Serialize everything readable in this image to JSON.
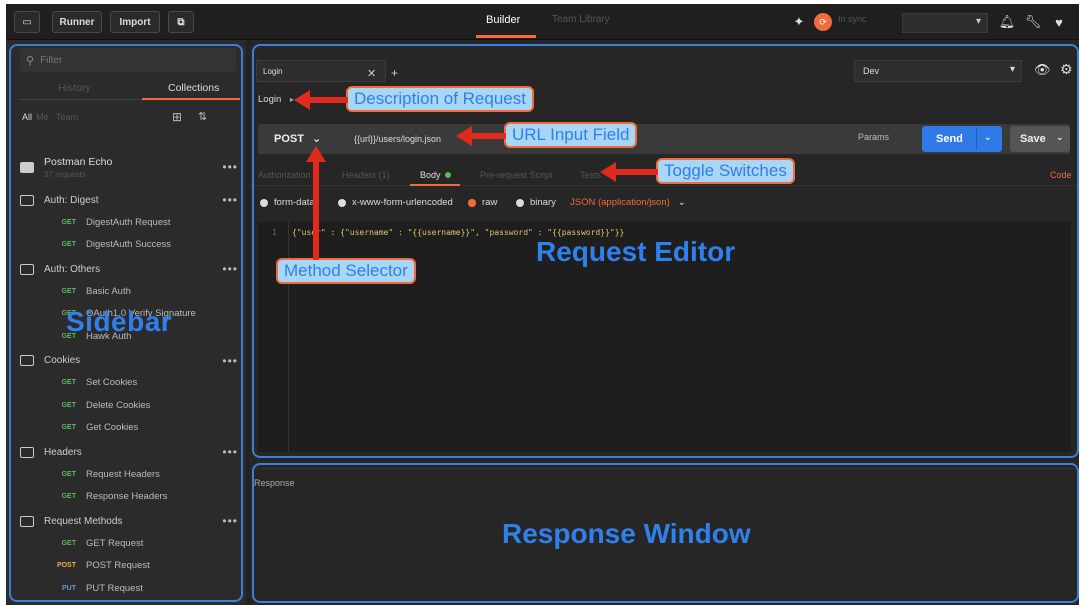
{
  "topbar": {
    "runner_label": "Runner",
    "import_label": "Import",
    "tab_builder": "Builder",
    "tab_team": "Team Library",
    "sync_label": "In sync"
  },
  "sidebar": {
    "filter_placeholder": "Filter",
    "tab_history": "History",
    "tab_collections": "Collections",
    "all_label": "All",
    "me_label": "Me",
    "team_label": "Team",
    "overlay_label": "Sidebar",
    "collection": {
      "name": "Postman Echo",
      "count": "37 requests"
    },
    "folders": [
      {
        "name": "Auth: Digest",
        "requests": [
          {
            "method": "GET",
            "name": "DigestAuth Request"
          },
          {
            "method": "GET",
            "name": "DigestAuth Success"
          }
        ]
      },
      {
        "name": "Auth: Others",
        "requests": [
          {
            "method": "GET",
            "name": "Basic Auth"
          },
          {
            "method": "GET",
            "name": "OAuth1.0 Verify Signature"
          },
          {
            "method": "GET",
            "name": "Hawk Auth"
          }
        ]
      },
      {
        "name": "Cookies",
        "requests": [
          {
            "method": "GET",
            "name": "Set Cookies"
          },
          {
            "method": "GET",
            "name": "Delete Cookies"
          },
          {
            "method": "GET",
            "name": "Get Cookies"
          }
        ]
      },
      {
        "name": "Headers",
        "requests": [
          {
            "method": "GET",
            "name": "Request Headers"
          },
          {
            "method": "GET",
            "name": "Response Headers"
          }
        ]
      },
      {
        "name": "Request Methods",
        "requests": [
          {
            "method": "GET",
            "name": "GET Request"
          },
          {
            "method": "POST",
            "name": "POST Request"
          },
          {
            "method": "PUT",
            "name": "PUT Request"
          }
        ]
      }
    ]
  },
  "editor": {
    "tab_name": "Login",
    "environment": "Dev",
    "request_name": "Login",
    "method": "POST",
    "url": "{{url}}/users/login.json",
    "params_label": "Params",
    "send_label": "Send",
    "save_label": "Save",
    "subtabs": [
      "Authorization",
      "Headers (1)",
      "Body",
      "Pre-request Script",
      "Tests"
    ],
    "code_link": "Code",
    "body_modes": [
      "form-data",
      "x-www-form-urlencoded",
      "raw",
      "binary"
    ],
    "body_type": "JSON (application/json)",
    "code_line_no": "1",
    "code_text": "{\"user\" : {\"username\" : \"{{username}}\", \"password\" : \"{{password}}\"}}",
    "overlay_label": "Request Editor"
  },
  "response": {
    "label": "Response",
    "overlay_label": "Response Window"
  },
  "annotations": {
    "description": "Description of Request",
    "url_field": "URL Input Field",
    "toggles": "Toggle Switches",
    "method": "Method Selector"
  },
  "colors": {
    "accent_orange": "#f26b3a",
    "send_blue": "#2f7ae5",
    "frame_blue": "#3d7fd8",
    "annotation_text": "#2f80ed",
    "arrow_red": "#e02b1c"
  }
}
